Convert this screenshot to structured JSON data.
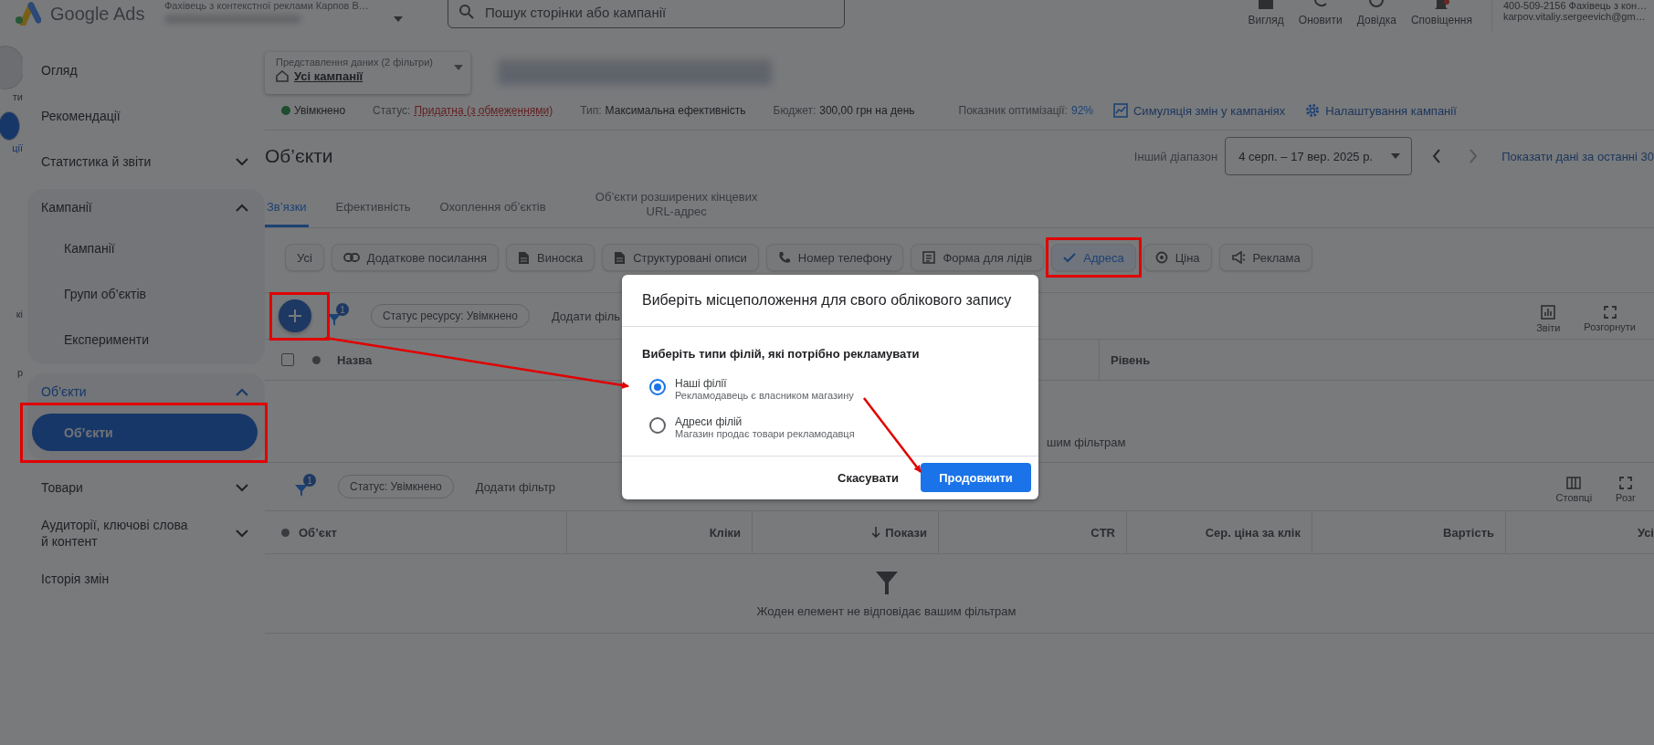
{
  "header": {
    "logo": "Google Ads",
    "account_name": "Фахівець з контекстної реклами Карпов В…",
    "search": {
      "placeholder": "Пошук сторінки або кампанії"
    },
    "actions": [
      {
        "label": "Вигляд",
        "kind": "view"
      },
      {
        "label": "Оновити",
        "kind": "refresh"
      },
      {
        "label": "Довідка",
        "kind": "help"
      },
      {
        "label": "Сповіщення",
        "kind": "bell"
      }
    ],
    "account": {
      "line_1": "400-509-2156 Фахівець з кон…",
      "line_2": "karpov.vitaliy.sergeevich@gm…"
    }
  },
  "rail": [
    "ти",
    "ції",
    "кі",
    "р"
  ],
  "sidebar": {
    "items": [
      {
        "kind": "item",
        "label": "Огляд",
        "selected": false
      },
      {
        "kind": "item",
        "label": "Рекомендації",
        "selected": false
      },
      {
        "kind": "group",
        "label": "Статистика й звіти",
        "expanded": false,
        "selected": false
      },
      {
        "kind": "group",
        "label": "Кампанії",
        "expanded": true,
        "selected": false,
        "children": [
          {
            "label": "Кампанії",
            "selected": false,
            "highlighted": false
          },
          {
            "label": "Групи об’єктів",
            "selected": false,
            "highlighted": false
          },
          {
            "label": "Експерименти",
            "selected": false,
            "highlighted": false
          }
        ]
      },
      {
        "kind": "group",
        "label": "Об’єкти",
        "expanded": true,
        "selected": true,
        "children": [
          {
            "label": "Об’єкти",
            "selected": true,
            "highlighted": true
          }
        ]
      },
      {
        "kind": "group",
        "label": "Товари",
        "expanded": false,
        "selected": false
      },
      {
        "kind": "group",
        "label": "Аудиторії, ключові слова й контент",
        "expanded": false,
        "selected": false
      },
      {
        "kind": "item",
        "label": "Історія змін",
        "selected": false
      }
    ]
  },
  "view_selector": {
    "label": "Представлення даних (2 фільтри)",
    "value": "Усі кампанії"
  },
  "campaign_status": {
    "state": "Увімкнено",
    "status": {
      "label": "Статус:",
      "value": "Придатна (з обмеженнями)"
    },
    "type": {
      "label": "Тип:",
      "value": "Максимальна ефективність"
    },
    "budget": {
      "label": "Бюджет:",
      "value": "300,00 грн на день"
    },
    "optimization": {
      "label": "Показник оптимізації:",
      "value": "92%"
    },
    "links": [
      {
        "label": "Симуляція змін у кампаніях",
        "kind": "chart"
      },
      {
        "label": "Налаштування кампанії",
        "kind": "gear"
      }
    ]
  },
  "page_title": "Об’єкти",
  "date_range": {
    "label": "Інший діапазон",
    "value": "4 серп. – 17 вер. 2025 р.",
    "link": "Показати дані за останні 30"
  },
  "tabs": [
    {
      "label": "Зв’язки",
      "selected": true
    },
    {
      "label": "Ефективність",
      "selected": false
    },
    {
      "label": "Охоплення об’єктів",
      "selected": false
    },
    {
      "label": "Об’єкти розширених кінцевих URL-адрес",
      "selected": false
    }
  ],
  "asset_types": [
    {
      "label": "Усі",
      "kind": "all",
      "selected": false,
      "highlighted": false
    },
    {
      "label": "Додаткове посилання",
      "kind": "link",
      "selected": false,
      "highlighted": false
    },
    {
      "label": "Виноска",
      "kind": "doc",
      "selected": false,
      "highlighted": false
    },
    {
      "label": "Структуровані описи",
      "kind": "doc",
      "selected": false,
      "highlighted": false
    },
    {
      "label": "Номер телефону",
      "kind": "phone",
      "selected": false,
      "highlighted": false
    },
    {
      "label": "Форма для лідів",
      "kind": "form",
      "selected": false,
      "highlighted": false
    },
    {
      "label": "Адреса",
      "selected": true,
      "highlighted": true
    },
    {
      "label": "Ціна",
      "kind": "price",
      "selected": false,
      "highlighted": false
    },
    {
      "label": "Реклама",
      "kind": "megaphone",
      "selected": false,
      "highlighted": false
    }
  ],
  "asset_toolbar": {
    "add_button": {
      "highlighted": true
    },
    "filter_count": "1",
    "filter_chip": "Статус ресурсу: Увімкнено",
    "add_filter": "Додати філь",
    "actions": [
      {
        "label": "Звіти",
        "kind": "chart"
      },
      {
        "label": "Розгорнути",
        "kind": "expand"
      }
    ]
  },
  "asset_table": {
    "select_all": {
      "checked": false
    },
    "columns": [
      "Назва",
      "Рівень"
    ],
    "empty_message": "шим фільтрам"
  },
  "results": {
    "filter_count": "1",
    "filter_chip": "Статус: Увімкнено",
    "add_filter": "Додати фільтр",
    "actions": [
      {
        "label": "Стовпці",
        "kind": "columns"
      },
      {
        "label": "Розг",
        "kind": "expand"
      }
    ],
    "columns": [
      {
        "label": "Об’єкт",
        "sorted": false
      },
      {
        "label": "Кліки",
        "sorted": false
      },
      {
        "label": "Покази",
        "sorted": true
      },
      {
        "label": "CTR",
        "sorted": false
      },
      {
        "label": "Сер. ціна за клік",
        "sorted": false
      },
      {
        "label": "Вартість",
        "sorted": false
      },
      {
        "label": "Усі",
        "sorted": false
      }
    ],
    "empty_message": "Жоден елемент не відповідає вашим фільтрам"
  },
  "dialog": {
    "title": "Виберіть місцеположення для свого облікового запису",
    "question": "Виберіть типи філій, які потрібно рекламувати",
    "options": [
      {
        "label": "Наші філії",
        "description": "Рекламодавець є власником магазину",
        "selected": true
      },
      {
        "label": "Адреси філій",
        "description": "Магазин продає товари рекламодавця",
        "selected": false
      }
    ],
    "buttons": [
      {
        "label": "Скасувати",
        "kind": "text"
      },
      {
        "label": "Продовжити",
        "kind": "primary"
      }
    ]
  }
}
